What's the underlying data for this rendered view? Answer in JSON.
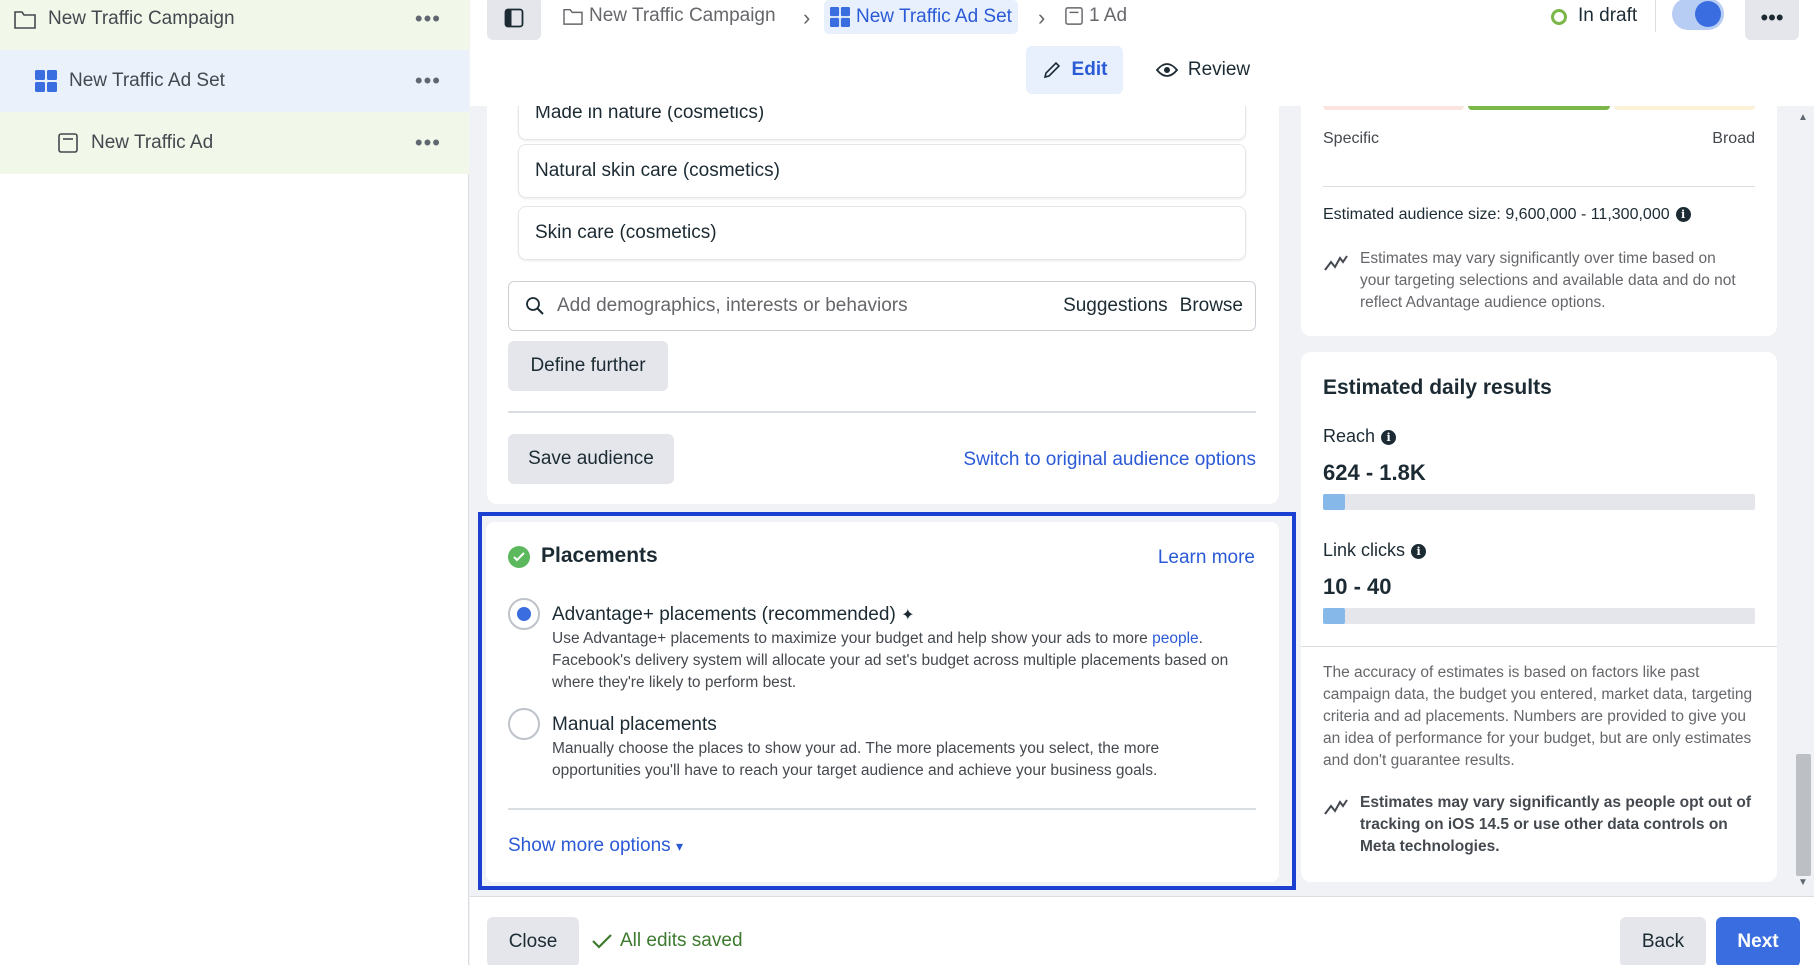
{
  "tree": {
    "campaign": "New Traffic Campaign",
    "adset": "New Traffic Ad Set",
    "ad": "New Traffic Ad",
    "more_glyph": "•••"
  },
  "breadcrumb": {
    "campaign": "New Traffic Campaign",
    "adset": "New Traffic Ad Set",
    "ad": "1 Ad",
    "separator": "›"
  },
  "status": {
    "text": "In draft"
  },
  "top_more_glyph": "•••",
  "tabs": {
    "edit": "Edit",
    "review": "Review"
  },
  "audience": {
    "interests": [
      "Made in nature (cosmetics)",
      "Natural skin care (cosmetics)",
      "Skin care (cosmetics)"
    ],
    "search_placeholder": "Add demographics, interests or behaviors",
    "suggestions": "Suggestions",
    "browse": "Browse",
    "define_further": "Define further",
    "save_audience": "Save audience",
    "switch_link": "Switch to original audience options"
  },
  "placements": {
    "title": "Placements",
    "learn_more": "Learn more",
    "advantage_label": "Advantage+ placements (recommended)",
    "advantage_sparkle": "✦",
    "advantage_desc_1": "Use Advantage+ placements to maximize your budget and help show your ads to more ",
    "advantage_desc_link": "people",
    "advantage_desc_2": ". Facebook's delivery system will allocate your ad set's budget across multiple placements based on where they're likely to perform best.",
    "manual_label": "Manual placements",
    "manual_desc": "Manually choose the places to show your ad. The more placements you select, the more opportunities you'll have to reach your target audience and achieve your business goals.",
    "show_more": "Show more options",
    "show_more_caret": "▾",
    "selected": "advantage"
  },
  "audience_definition": {
    "specific": "Specific",
    "broad": "Broad",
    "estimated_size": "Estimated audience size: 9,600,000 - 11,300,000",
    "note": "Estimates may vary significantly over time based on your targeting selections and available data and do not reflect Advantage audience options."
  },
  "daily_results": {
    "title": "Estimated daily results",
    "reach_label": "Reach",
    "reach_value": "624 - 1.8K",
    "reach_fill": 0.05,
    "clicks_label": "Link clicks",
    "clicks_value": "10 - 40",
    "clicks_fill": 0.05,
    "accuracy": "The accuracy of estimates is based on factors like past campaign data, the budget you entered, market data, targeting criteria and ad placements. Numbers are provided to give you an idea of performance for your budget, but are only estimates and don't guarantee results.",
    "ios_note": "Estimates may vary significantly as people opt out of tracking on iOS 14.5 or use other data controls on Meta technologies."
  },
  "info_glyph": "i",
  "footer": {
    "close": "Close",
    "saved": "All edits saved",
    "back": "Back",
    "next": "Next"
  },
  "colors": {
    "accent": "#3a6ee0",
    "link": "#2b5ad6",
    "success": "#5cb85c",
    "highlight_outline": "#1a3fd1",
    "draft_dot": "#7ab648"
  }
}
